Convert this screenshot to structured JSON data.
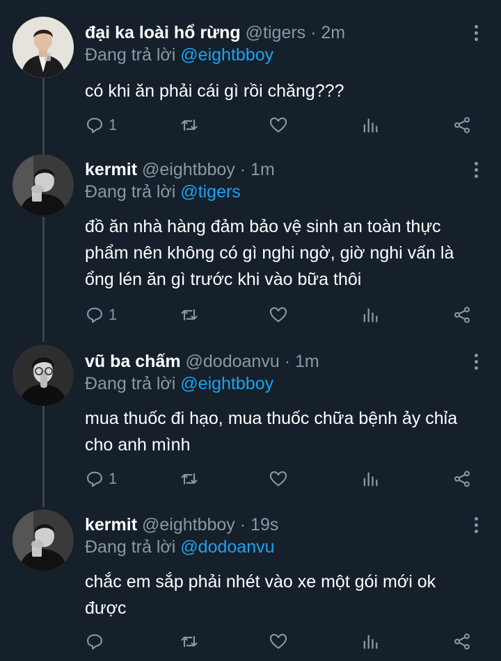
{
  "tweets": [
    {
      "name": "đại ka loài hổ rừng",
      "handle": "@tigers",
      "time": "· 2m",
      "replying_label": "Đang trả lời",
      "replying_to": "@eightbboy",
      "lines": [
        "có khi ăn phải cái gì rồi chăng???"
      ],
      "reply_count": "1"
    },
    {
      "name": "kermit",
      "handle": "@eightbboy",
      "time": "· 1m",
      "replying_label": "Đang trả lời",
      "replying_to": "@tigers",
      "lines": [
        "đồ ăn nhà hàng đảm bảo vệ sinh an toàn thực",
        "phẩm nên không có gì nghi ngờ, giờ nghi vấn là",
        "ổng lén ăn gì trước khi vào bữa thôi"
      ],
      "reply_count": "1"
    },
    {
      "name": "vũ ba chấm",
      "handle": "@dodoanvu",
      "time": "· 1m",
      "replying_label": "Đang trả lời",
      "replying_to": "@eightbboy",
      "lines": [
        "mua thuốc đi hạo, mua thuốc chữa bệnh ảy chỉa",
        "cho anh mình"
      ],
      "reply_count": "1"
    },
    {
      "name": "kermit",
      "handle": "@eightbboy",
      "time": "· 19s",
      "replying_label": "Đang trả lời",
      "replying_to": "@dodoanvu",
      "lines": [
        "chắc em sắp phải nhét vào xe một gói mới ok",
        "được"
      ],
      "reply_count": ""
    }
  ],
  "colors": {
    "background": "#15202b",
    "secondary_text": "#8899a6",
    "link": "#1da1f2",
    "thread_line": "#38444d"
  },
  "icons": {
    "reply": "reply-icon",
    "retweet": "retweet-icon",
    "like": "heart-icon",
    "analytics": "analytics-icon",
    "share": "share-icon",
    "more": "more-vertical-icon"
  }
}
